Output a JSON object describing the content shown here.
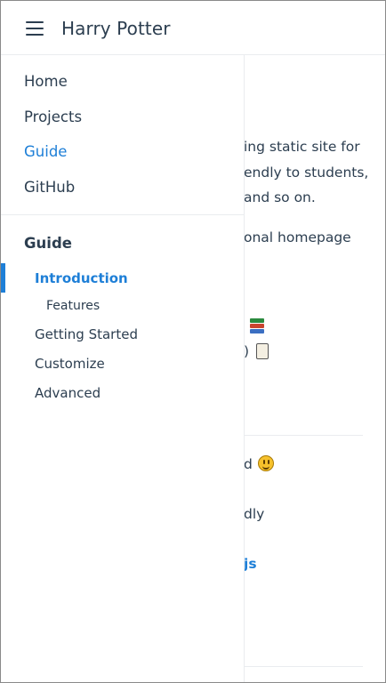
{
  "header": {
    "title": "Harry Potter"
  },
  "nav": {
    "links": [
      {
        "label": "Home"
      },
      {
        "label": "Projects"
      },
      {
        "label": "Guide",
        "active": true
      },
      {
        "label": "GitHub"
      }
    ]
  },
  "sidebar": {
    "group_title": "Guide",
    "items": [
      {
        "label": "Introduction",
        "active": true
      },
      {
        "label": "Features",
        "sub": true
      },
      {
        "label": "Getting Started"
      },
      {
        "label": "Customize"
      },
      {
        "label": "Advanced"
      }
    ]
  },
  "content": {
    "lines": [
      "ing static site for",
      "endly to students,",
      "and so on.",
      "onal homepage",
      ")",
      "d",
      "dly",
      "js"
    ]
  },
  "colors": {
    "accent": "#1e7fd7",
    "text": "#2c3e50",
    "border": "#eaecef"
  },
  "icons": {
    "menu": "hamburger-menu-icon",
    "books": "books-emoji-icon",
    "scroll": "scroll-emoji-icon",
    "smile": "smiling-face-emoji-icon"
  }
}
